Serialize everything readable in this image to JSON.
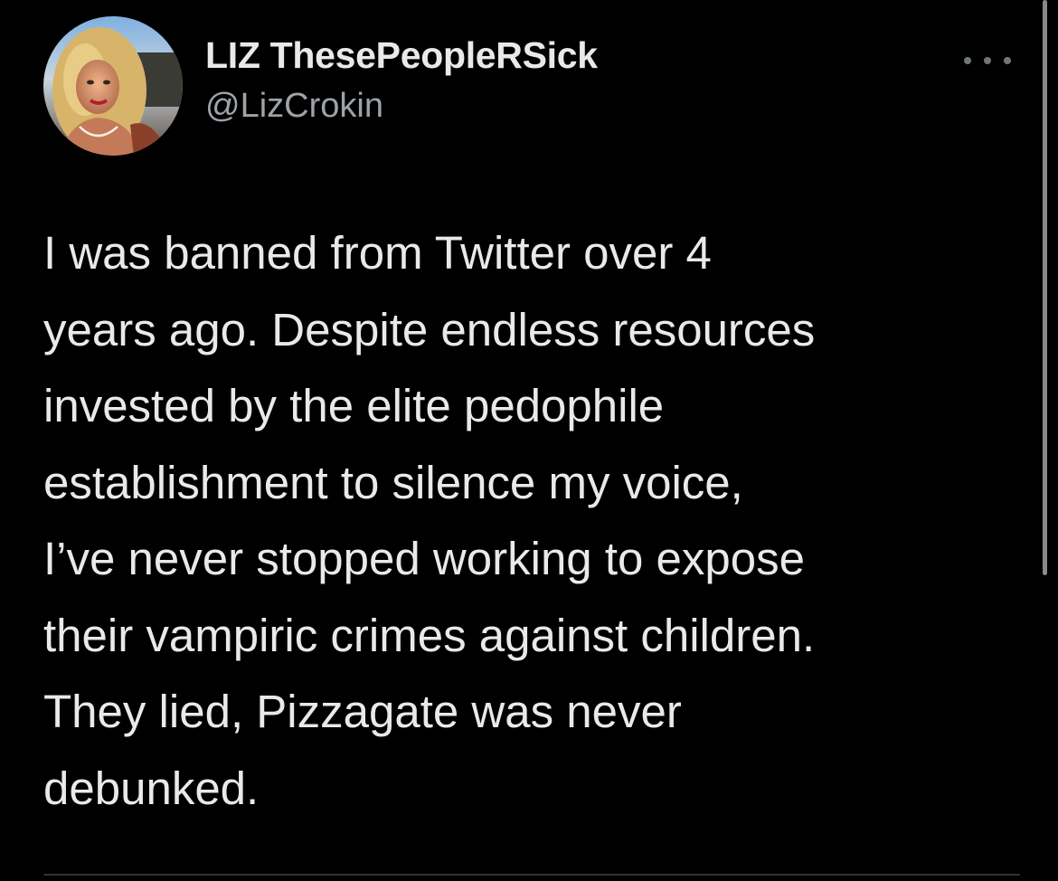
{
  "tweet": {
    "author": {
      "display_name": "LIZ ThesePeopleRSick",
      "handle": "@LizCrokin",
      "avatar": "profile-photo"
    },
    "more_icon": "more-options-icon",
    "text_lines": [
      "I was banned from Twitter over 4",
      "years ago. Despite endless resources",
      "invested by the elite pedophile",
      "establishment to silence my voice,",
      "I’ve never stopped working to expose",
      "their vampiric crimes against children.",
      "They lied, Pizzagate was never",
      "debunked."
    ]
  },
  "colors": {
    "background": "#000000",
    "primary_text": "#e7e9ea",
    "secondary_text": "#9ea3a8",
    "icon": "#6e767d"
  }
}
